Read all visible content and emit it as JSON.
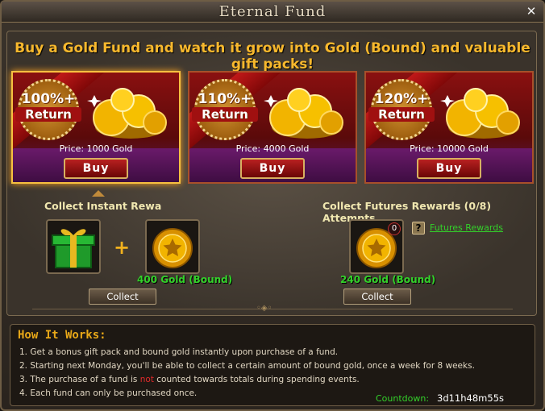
{
  "window": {
    "title": "Eternal Fund"
  },
  "headline": "Buy a Gold Fund and watch it grow into Gold (Bound) and valuable gift packs!",
  "funds": [
    {
      "pct": "100%+",
      "ret": "Return",
      "price": "Price: 1000 Gold",
      "buy": "Buy"
    },
    {
      "pct": "110%+",
      "ret": "Return",
      "price": "Price: 4000 Gold",
      "buy": "Buy"
    },
    {
      "pct": "120%+",
      "ret": "Return",
      "price": "Price: 10000 Gold",
      "buy": "Buy"
    }
  ],
  "instant": {
    "label": "Collect Instant Rewa",
    "gold": "400 Gold (Bound)",
    "collect": "Collect"
  },
  "futures": {
    "label": "Collect Futures Rewards (0/8) Attempts",
    "count": "0",
    "help": "?",
    "link": "Futures Rewards",
    "gold": "240 Gold (Bound)",
    "collect": "Collect"
  },
  "how": {
    "title": "How It Works:",
    "line1": "1. Get a bonus gift pack and bound gold instantly upon purchase of a fund.",
    "line2": "2. Starting next Monday, you'll be able to collect a certain amount of bound gold, once a week for 8 weeks.",
    "line3_pre": "3. The purchase of a fund is ",
    "line3_not": "not",
    "line3_post": " counted towards totals during spending events.",
    "line4": "4. Each fund can only be purchased once."
  },
  "countdown": {
    "label": "Countdown:",
    "value": "3d11h48m55s"
  },
  "icons": {
    "close": "close-icon",
    "gift": "gift-box-icon",
    "coin": "gold-coin-icon",
    "help": "question-icon"
  },
  "colors": {
    "accent_gold": "#f7b82d",
    "green_text": "#33d12a",
    "card_red": "#8a1010",
    "card_purple": "#5a1c5a"
  }
}
